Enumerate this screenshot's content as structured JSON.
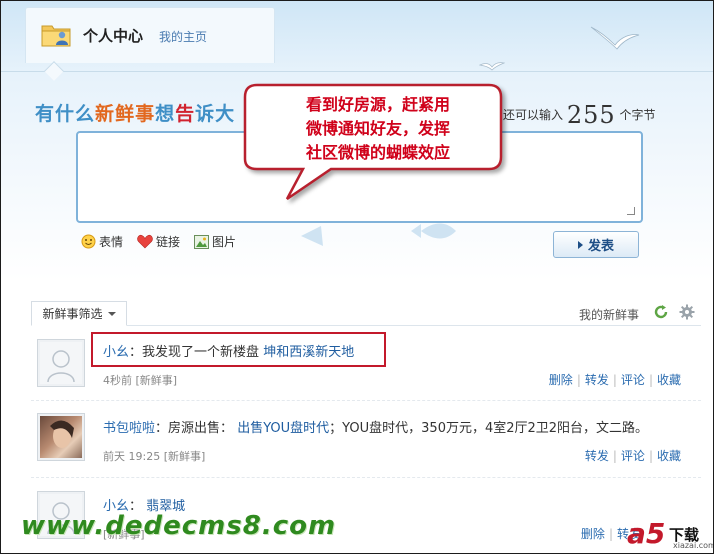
{
  "header": {
    "title": "个人中心",
    "home_link": "我的主页"
  },
  "composer": {
    "prompt_chars": [
      {
        "ch": "有",
        "color": "#3f8fc6"
      },
      {
        "ch": "什",
        "color": "#3f8fc6"
      },
      {
        "ch": "么",
        "color": "#3f8fc6"
      },
      {
        "ch": "新",
        "color": "#e2681f"
      },
      {
        "ch": "鲜",
        "color": "#e2681f"
      },
      {
        "ch": "事",
        "color": "#e2681f"
      },
      {
        "ch": "想",
        "color": "#3f8fc6"
      },
      {
        "ch": "告",
        "color": "#d1232f"
      },
      {
        "ch": "诉",
        "color": "#3f8fc6"
      },
      {
        "ch": "大",
        "color": "#3f8fc6"
      }
    ],
    "count_prefix": "还可以输入",
    "count_value": "255",
    "count_suffix": "个字节",
    "emoticon_label": "表情",
    "link_label": "链接",
    "image_label": "图片",
    "publish_label": "发表"
  },
  "callout": {
    "lines": [
      "看到好房源，赶紧用",
      "微博通知好友，发挥",
      "社区微博的蝴蝶效应"
    ],
    "color": "#d0021b"
  },
  "feed": {
    "filter_label": "新鲜事筛选",
    "my_news_label": "我的新鲜事",
    "items": [
      {
        "user": "小幺",
        "colon": "：",
        "text": "我发现了一个新楼盘",
        "link": "坤和西溪新天地",
        "text_after": "",
        "time": "4秒前",
        "tag": "[新鲜事]",
        "actions": [
          "删除",
          "转发",
          "评论",
          "收藏"
        ]
      },
      {
        "user": "书包啦啦",
        "colon": "：",
        "text": "房源出售：",
        "link": "出售YOU盘时代",
        "text_after": "；YOU盘时代，350万元，4室2厅2卫2阳台，文二路。",
        "time": "前天 19:25",
        "tag": "[新鲜事]",
        "actions": [
          "转发",
          "评论",
          "收藏"
        ]
      },
      {
        "user": "小幺",
        "colon": "：",
        "text": "",
        "link": "翡翠城",
        "text_after": "",
        "time": "",
        "tag": "[新鲜事]",
        "actions": [
          "删除",
          "转发"
        ]
      }
    ]
  },
  "watermark": {
    "site": "www.dedecms8.com",
    "brand": "a5",
    "brand_suffix": "下载",
    "brand_url": "xiazai.com"
  }
}
